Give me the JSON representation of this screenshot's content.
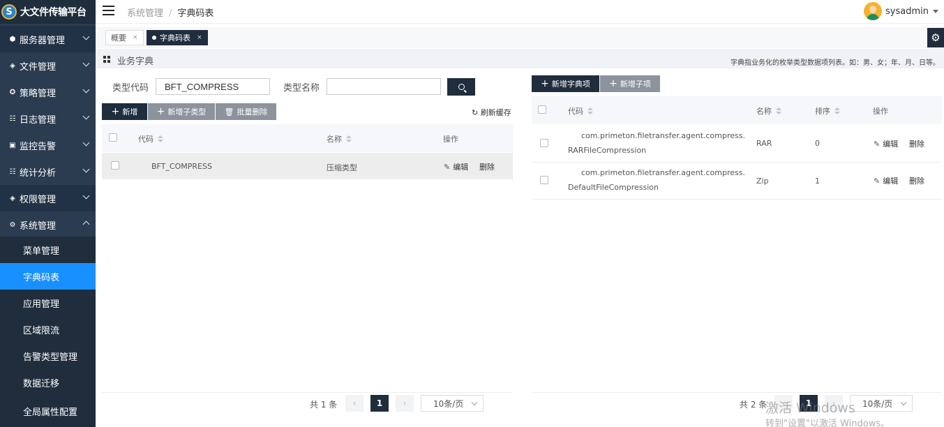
{
  "app": {
    "title": "大文件传输平台",
    "logo_glyph": "S"
  },
  "sidebar": {
    "menus": [
      {
        "label": "服务器管理",
        "icon": "cube-icon"
      },
      {
        "label": "文件管理",
        "icon": "layers-icon"
      },
      {
        "label": "策略管理",
        "icon": "strategy-icon"
      },
      {
        "label": "日志管理",
        "icon": "log-icon"
      },
      {
        "label": "监控告警",
        "icon": "monitor-icon"
      },
      {
        "label": "统计分析",
        "icon": "chart-icon"
      },
      {
        "label": "权限管理",
        "icon": "layers-icon"
      },
      {
        "label": "系统管理",
        "icon": "gear-icon"
      }
    ],
    "submenu": [
      "菜单管理",
      "字典码表",
      "应用管理",
      "区域限流",
      "告警类型管理",
      "数据迁移",
      "全局属性配置"
    ]
  },
  "header": {
    "breadcrumb": [
      "系统管理",
      "字典码表"
    ],
    "breadcrumb_sep": "/",
    "user": "sysadmin"
  },
  "tabs": [
    {
      "label": "概要",
      "close": "×"
    },
    {
      "label": "字典码表",
      "close": "×"
    }
  ],
  "section": {
    "title": "业务字典",
    "description": "字典指业务化的枚举类型数据项列表。如：男、女；年、月、日等。"
  },
  "left": {
    "search": {
      "code_label": "类型代码",
      "code_value": "BFT_COMPRESS",
      "name_label": "类型名称",
      "name_value": ""
    },
    "buttons": {
      "add": "新增",
      "add_sub": "新增子类型",
      "batch_delete": "批量删除",
      "refresh": "刷新缓存"
    },
    "columns": {
      "code": "代码",
      "name": "名称",
      "ops": "操作"
    },
    "rows": [
      {
        "code": "BFT_COMPRESS",
        "name": "压缩类型",
        "edit": "编辑",
        "delete": "删除"
      }
    ],
    "pagination": {
      "total": "共 1 条",
      "page": "1",
      "size": "10条/页",
      "prev": "‹",
      "next": "›"
    }
  },
  "right": {
    "buttons": {
      "add_item": "新增字典项",
      "add_child": "新增子项"
    },
    "columns": {
      "code": "代码",
      "name": "名称",
      "sort": "排序",
      "ops": "操作"
    },
    "rows": [
      {
        "code": "com.primeton.filetransfer.agent.compress.RARFileCompression",
        "name": "RAR",
        "sort": "0",
        "edit": "编辑",
        "delete": "删除"
      },
      {
        "code": "com.primeton.filetransfer.agent.compress.DefaultFileCompression",
        "name": "Zip",
        "sort": "1",
        "edit": "编辑",
        "delete": "删除"
      }
    ],
    "pagination": {
      "total": "共 2 条",
      "page": "1",
      "size": "10条/页"
    }
  },
  "watermark": {
    "line1": "激活 Windows",
    "line2": "转到\"设置\"以激活 Windows。"
  }
}
